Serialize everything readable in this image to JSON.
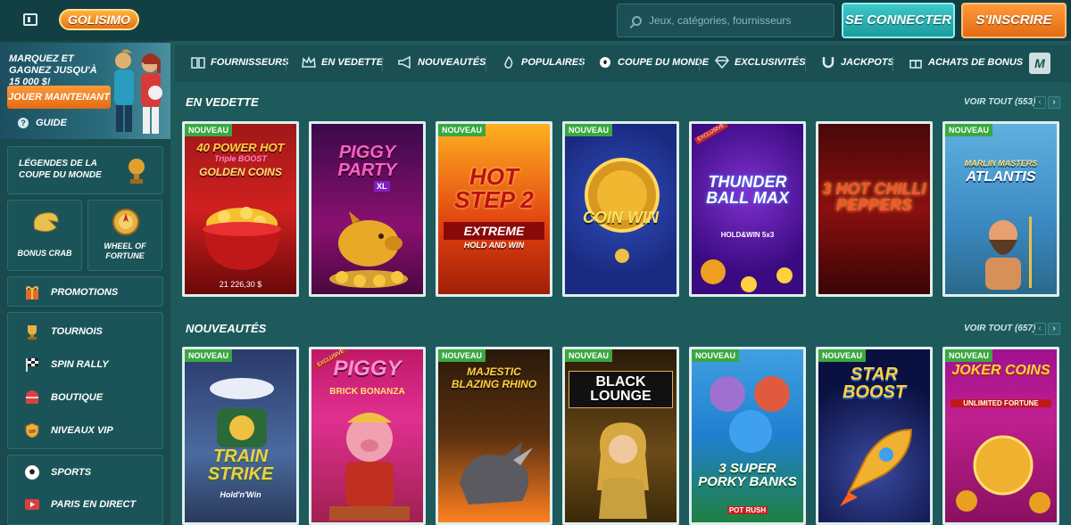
{
  "header": {
    "logo": "GOLISIMO",
    "search_placeholder": "Jeux, catégories, fournisseurs",
    "login_label": "SE CONNECTER",
    "signup_label": "S'INSCRIRE"
  },
  "sidebar": {
    "promo_text": "MARQUEZ ET GAGNEZ JUSQU'À 15 000 $!",
    "promo_button": "JOUER MAINTENANT",
    "guide": "GUIDE",
    "legends": "LÉGENDES DE LA COUPE DU MONDE",
    "bonus_crab": "BONUS CRAB",
    "wheel_of_fortune": "WHEEL OF FORTUNE",
    "promotions": "PROMOTIONS",
    "tournois": "TOURNOIS",
    "spin_rally": "SPIN RALLY",
    "boutique": "BOUTIQUE",
    "niveaux_vip": "NIVEAUX VIP",
    "sports": "SPORTS",
    "paris_direct": "PARIS EN DIRECT"
  },
  "categories": [
    {
      "label": "FOURNISSEURS",
      "icon": "book-icon"
    },
    {
      "label": "EN VEDETTE",
      "icon": "crown-icon"
    },
    {
      "label": "NOUVEAUTÉS",
      "icon": "megaphone-icon"
    },
    {
      "label": "POPULAIRES",
      "icon": "flame-icon"
    },
    {
      "label": "COUPE DU MONDE",
      "icon": "football-icon"
    },
    {
      "label": "EXCLUSIVITÉS",
      "icon": "diamond-icon"
    },
    {
      "label": "JACKPOTS",
      "icon": "horseshoe-icon"
    },
    {
      "label": "ACHATS DE BONUS",
      "icon": "gift-icon"
    }
  ],
  "featured": {
    "title": "EN VEDETTE",
    "see_all": "VOIR TOUT (553)",
    "games": [
      {
        "badge": "NOUVEAU",
        "title": "40 POWER HOT",
        "sub": "Triple BOOST",
        "title2": "GOLDEN COINS",
        "jackpot": "21 226,30 $"
      },
      {
        "badge": "",
        "title": "PIGGY PARTY",
        "sub": "XL"
      },
      {
        "badge": "NOUVEAU",
        "title": "HOT STEP 2",
        "sub": "EXTREME",
        "title2": "HOLD AND WIN"
      },
      {
        "badge": "NOUVEAU",
        "title": "COIN WIN"
      },
      {
        "badge": "",
        "title": "THUNDER BALL MAX",
        "sub": "HOLD&WIN 5x3",
        "exclusive": "EXCLUSIVE"
      },
      {
        "badge": "",
        "title": "3 HOT CHILLI PEPPERS"
      },
      {
        "badge": "NOUVEAU",
        "title": "MARLIN MASTERS",
        "title2": "ATLANTIS"
      }
    ]
  },
  "new": {
    "title": "NOUVEAUTÉS",
    "see_all": "VOIR TOUT (657)",
    "games": [
      {
        "badge": "NOUVEAU",
        "title": "TRAIN STRIKE",
        "sub": "Hold'n'Win"
      },
      {
        "badge": "",
        "title": "PIGGY",
        "sub": "BRICK BONANZA",
        "exclusive": "EXCLUSIVE"
      },
      {
        "badge": "NOUVEAU",
        "title": "MAJESTIC BLAZING RHINO"
      },
      {
        "badge": "NOUVEAU",
        "title": "BLACK LOUNGE"
      },
      {
        "badge": "NOUVEAU",
        "title": "3 SUPER PORKY BANKS",
        "sub": "POT RUSH"
      },
      {
        "badge": "NOUVEAU",
        "title": "STAR BOOST"
      },
      {
        "badge": "NOUVEAU",
        "title": "JOKER COINS",
        "sub": "UNLIMITED FORTUNE"
      }
    ]
  },
  "colors": {
    "background": "#1e5a5c",
    "topbar": "#123f44",
    "accent_teal": "#1a9c9e",
    "accent_orange": "#e56b12",
    "badge_green": "#3aa840"
  }
}
